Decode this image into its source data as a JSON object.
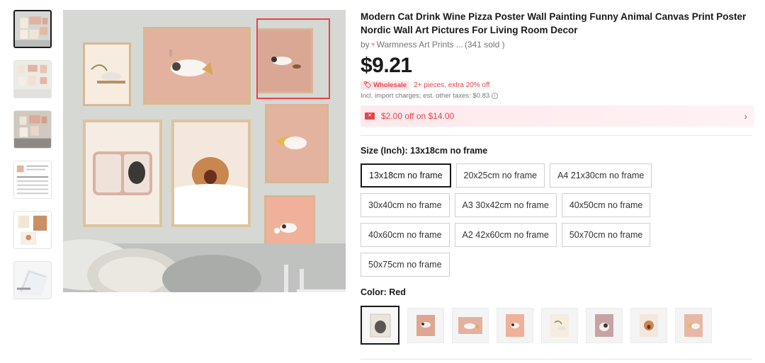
{
  "thumbnails": [
    {
      "name": "thumbnail-1",
      "active": true
    },
    {
      "name": "thumbnail-2",
      "active": false
    },
    {
      "name": "thumbnail-3",
      "active": false
    },
    {
      "name": "thumbnail-4",
      "active": false
    },
    {
      "name": "thumbnail-5",
      "active": false
    },
    {
      "name": "thumbnail-6",
      "active": false
    }
  ],
  "product": {
    "title": "Modern Cat Drink Wine Pizza Poster Wall Painting Funny Animal Canvas Print Poster Nordic Wall Art Pictures For Living Room Decor",
    "by": "by",
    "store": "Warmness Art Prints ...",
    "sold": "(341 sold )",
    "price": "$9.21",
    "wholesale_badge": "Wholesale",
    "wholesale_text": "2+ pieces, extra 20% off",
    "taxes": "Incl. import charges; est. other taxes: $0.83",
    "coupon": "$2.00 off on $14.00"
  },
  "size": {
    "label": "Size (Inch): 13x18cm no frame",
    "options": [
      "13x18cm no frame",
      "20x25cm no frame",
      "A4 21x30cm no frame",
      "30x40cm no frame",
      "A3 30x42cm no frame",
      "40x50cm no frame",
      "40x60cm no frame",
      "A2 42x60cm no frame",
      "50x70cm no frame",
      "50x75cm no frame"
    ],
    "selected": "13x18cm no frame"
  },
  "color": {
    "label": "Color: Red",
    "option_count": 8,
    "selected_index": 0
  },
  "colors": {
    "accent": "#e8434a",
    "text": "#191919",
    "muted": "#757575"
  }
}
